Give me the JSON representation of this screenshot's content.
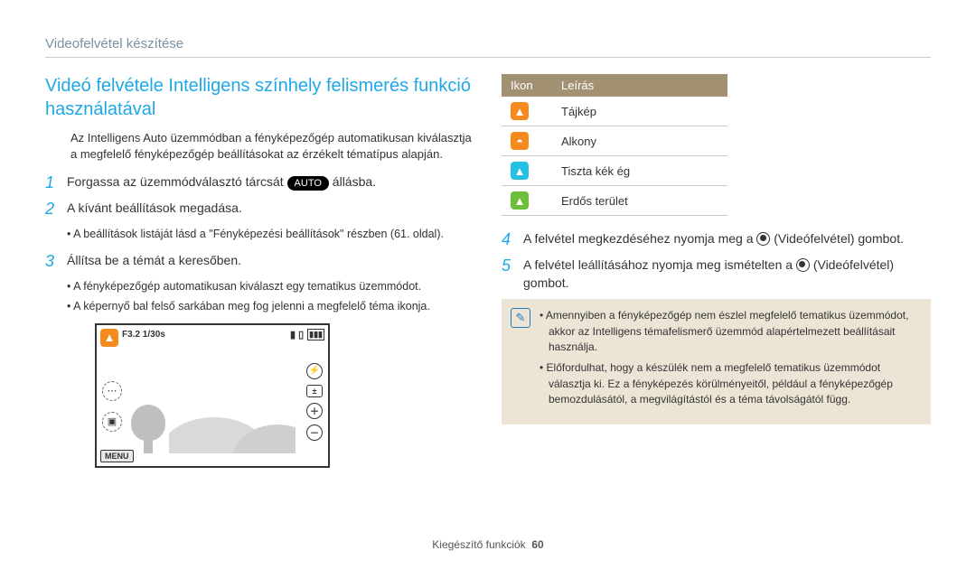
{
  "header": {
    "title": "Videofelvétel készítése"
  },
  "title": "Videó felvétele Intelligens színhely felismerés funkció használatával",
  "intro": "Az Intelligens Auto üzemmódban a fényképezőgép automatikusan kiválasztja a megfelelő fényképezőgép beállításokat az érzékelt tématípus alapján.",
  "steps": [
    {
      "num": "1",
      "text_before": "Forgassa az üzemmódválasztó tárcsát ",
      "auto": "AUTO",
      "text_after": " állásba."
    },
    {
      "num": "2",
      "text": "A kívánt beállítások megadása.",
      "sub": "A beállítások listáját lásd a \"Fényképezési beállítások\" részben (61. oldal)."
    },
    {
      "num": "3",
      "text": "Állítsa be a témát a keresőben.",
      "sub1": "A fényképezőgép automatikusan kiválaszt egy tematikus üzemmódot.",
      "sub2": "A képernyő bal felső sarkában meg fog jelenni a megfelelő téma ikonja."
    }
  ],
  "preview": {
    "exposure": "F3.2 1/30s",
    "menu": "MENU"
  },
  "table": {
    "header_icon": "Ikon",
    "header_desc": "Leírás",
    "rows": [
      {
        "label": "Tájkép",
        "cls": "ic-orange",
        "glyph": "▲"
      },
      {
        "label": "Alkony",
        "cls": "ic-orange2",
        "glyph": "◓"
      },
      {
        "label": "Tiszta kék ég",
        "cls": "ic-cyan",
        "glyph": "▲"
      },
      {
        "label": "Erdős terület",
        "cls": "ic-green",
        "glyph": "▲"
      }
    ]
  },
  "steps_right": [
    {
      "num": "4",
      "before": "A felvétel megkezdéséhez nyomja meg a ",
      "after": " (Videófelvétel) gombot."
    },
    {
      "num": "5",
      "before": "A felvétel leállításához nyomja meg ismételten a ",
      "after": " (Videófelvétel) gombot."
    }
  ],
  "notes": [
    "Amennyiben a fényképezőgép nem észlel megfelelő tematikus üzemmódot, akkor az Intelligens témafelismerő üzemmód alapértelmezett beállításait használja.",
    "Előfordulhat, hogy a készülék nem a megfelelő tematikus üzemmódot választja ki. Ez a fényképezés körülményeitől, például a fényképezőgép bemozdulásától, a megvilágítástól és a téma távolságától függ."
  ],
  "footer": {
    "section": "Kiegészítő funkciók",
    "page": "60"
  }
}
